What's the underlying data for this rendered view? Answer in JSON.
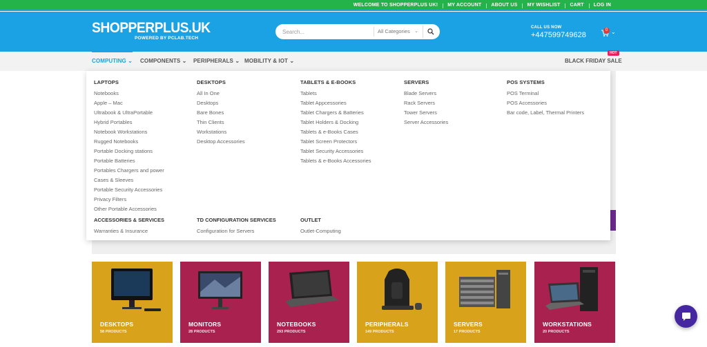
{
  "topbar": {
    "links": [
      "WELCOME TO SHOPPERPLUS UK!",
      "MY ACCOUNT",
      "ABOUT US",
      "MY WISHLIST",
      "CART",
      "LOG IN"
    ]
  },
  "header": {
    "logo_main": "SHOPPERPLUS.UK",
    "logo_sub": "POWERED BY PCLAB.TECH",
    "search_placeholder": "Search...",
    "search_category": "All Categories",
    "call_label": "CALL US NOW",
    "phone": "+447599749628",
    "cart_count": "0"
  },
  "nav": {
    "items": [
      "COMPUTING",
      "COMPONENTS",
      "PERIPHERALS",
      "MOBILITY & IOT"
    ],
    "right_item": "BLACK FRIDAY SALE",
    "hot_badge": "HOT"
  },
  "mega_menu": {
    "columns": [
      {
        "title": "LAPTOPS",
        "links": [
          "Notebooks",
          "Apple – Mac",
          "Ultrabook & UltraPortable",
          "Hybrid Portables",
          "Notebook Workstations",
          "Rugged Notebooks",
          "Portable Docking stations",
          "Portable Batteries",
          "Portables Chargers and power",
          "Cases & Sleeves",
          "Portable Security Accessories",
          "Privacy Filters",
          "Other Portable Accessories"
        ]
      },
      {
        "title": "DESKTOPS",
        "links": [
          "All In One",
          "Desktops",
          "Bare Bones",
          "Thin Clients",
          "Workstations",
          "Desktop Accessories"
        ]
      },
      {
        "title": "TABLETS & E-BOOKS",
        "links": [
          "Tablets",
          "Tablet Appcessories",
          "Tablet Chargers & Batteries",
          "Tablet Holders & Docking",
          "Tablets & e-Books Cases",
          "Tablet Screen Protectors",
          "Tablet Security Accessories",
          "Tablets & e-Books Accessories"
        ]
      },
      {
        "title": "SERVERS",
        "links": [
          "Blade Servers",
          "Rack Servers",
          "Tower Servers",
          "Server Accessories"
        ]
      },
      {
        "title": "POS SYSTEMS",
        "links": [
          "POS Terminal",
          "POS Accessories",
          "Bar code, Label, Thermal Printers"
        ]
      }
    ],
    "bottom_columns": [
      {
        "title": "ACCESSORIES & SERVICES",
        "links": [
          "Warranties & Insurance"
        ]
      },
      {
        "title": "TD CONFIGURATION SERVICES",
        "links": [
          "Configuration for Servers"
        ]
      },
      {
        "title": "OUTLET",
        "links": [
          "Outlet-Computing"
        ]
      }
    ]
  },
  "categories": [
    {
      "name": "DESKTOPS",
      "count": "58 PRODUCTS",
      "color": "#d9a21b"
    },
    {
      "name": "MONITORS",
      "count": "28 PRODUCTS",
      "color": "#a8214f"
    },
    {
      "name": "NOTEBOOKS",
      "count": "293 PRODUCTS",
      "color": "#a8214f"
    },
    {
      "name": "PERIPHERALS",
      "count": "149 PRODUCTS",
      "color": "#d9a21b"
    },
    {
      "name": "SERVERS",
      "count": "17 PRODUCTS",
      "color": "#d9a21b"
    },
    {
      "name": "WORKSTATIONS",
      "count": "20 PRODUCTS",
      "color": "#a8214f"
    }
  ],
  "colors": {
    "topbar": "#24b34a",
    "header": "#1aa2e4",
    "accent": "#1aa2e4",
    "chat": "#4527a0"
  }
}
